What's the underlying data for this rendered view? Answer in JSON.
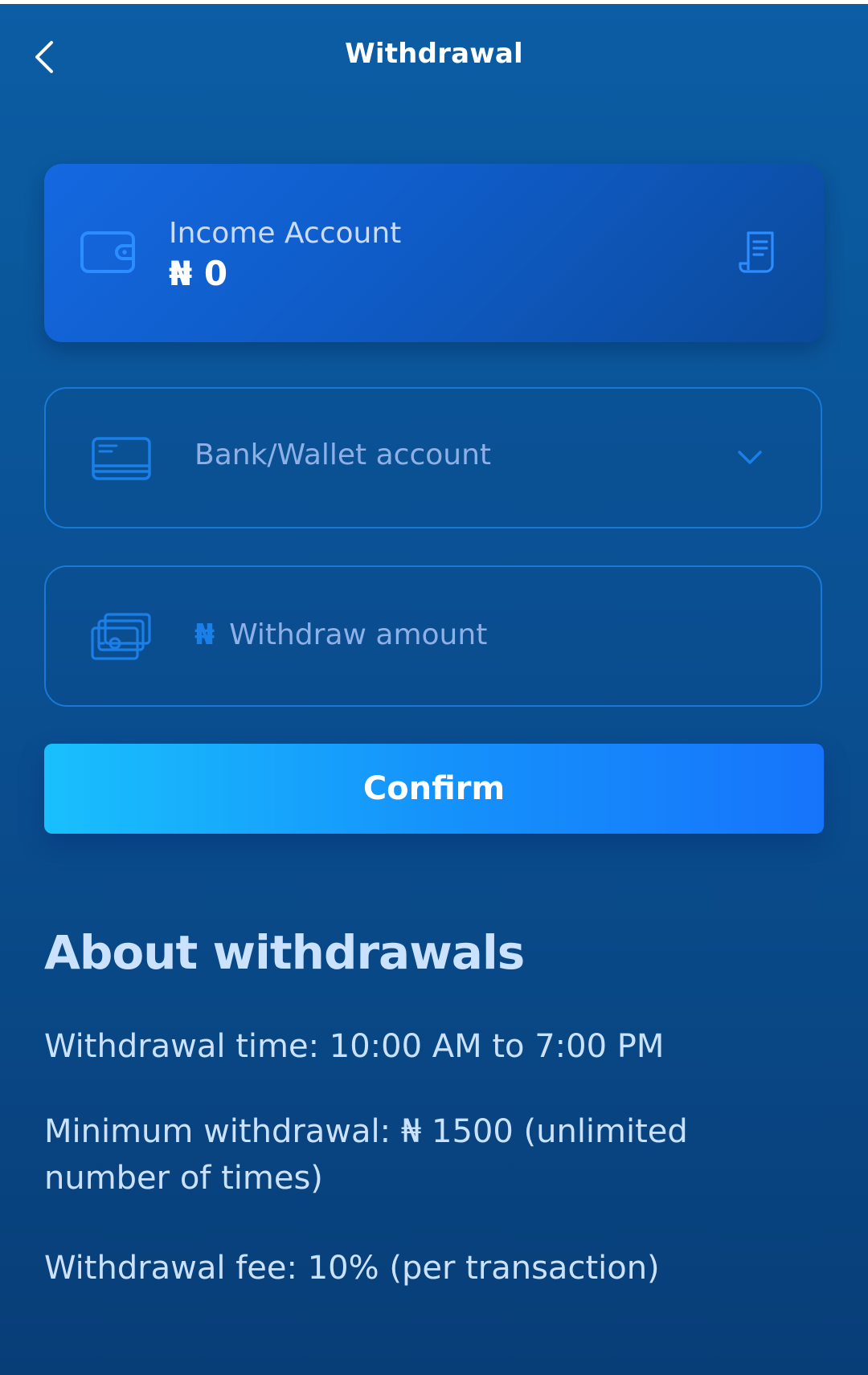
{
  "header": {
    "title": "Withdrawal",
    "back_icon": "chevron-left-icon"
  },
  "income_card": {
    "label": "Income Account",
    "amount": "₦ 0",
    "icon": "wallet-icon",
    "action_icon": "receipt-icon"
  },
  "bank_field": {
    "placeholder": "Bank/Wallet account",
    "icon": "credit-card-icon",
    "dropdown_icon": "chevron-down-icon"
  },
  "amount_field": {
    "currency_symbol": "₦",
    "placeholder": "Withdraw amount",
    "value": "",
    "icon": "cash-stack-icon"
  },
  "confirm": {
    "label": "Confirm"
  },
  "about": {
    "title": "About withdrawals",
    "lines": [
      "Withdrawal time: 10:00 AM to 7:00 PM",
      "Minimum withdrawal: ₦ 1500 (unlimited number of times)",
      "Withdrawal fee: 10% (per transaction)"
    ]
  },
  "colors": {
    "background_top": "#0b5da4",
    "background_bottom": "#083e78",
    "card": "#1568e0",
    "field_border": "#1a78d6",
    "accent_icon": "#1b7fe8",
    "confirm_start": "#19c0fd",
    "confirm_end": "#1674fb",
    "about_text": "#cbe2ff"
  }
}
